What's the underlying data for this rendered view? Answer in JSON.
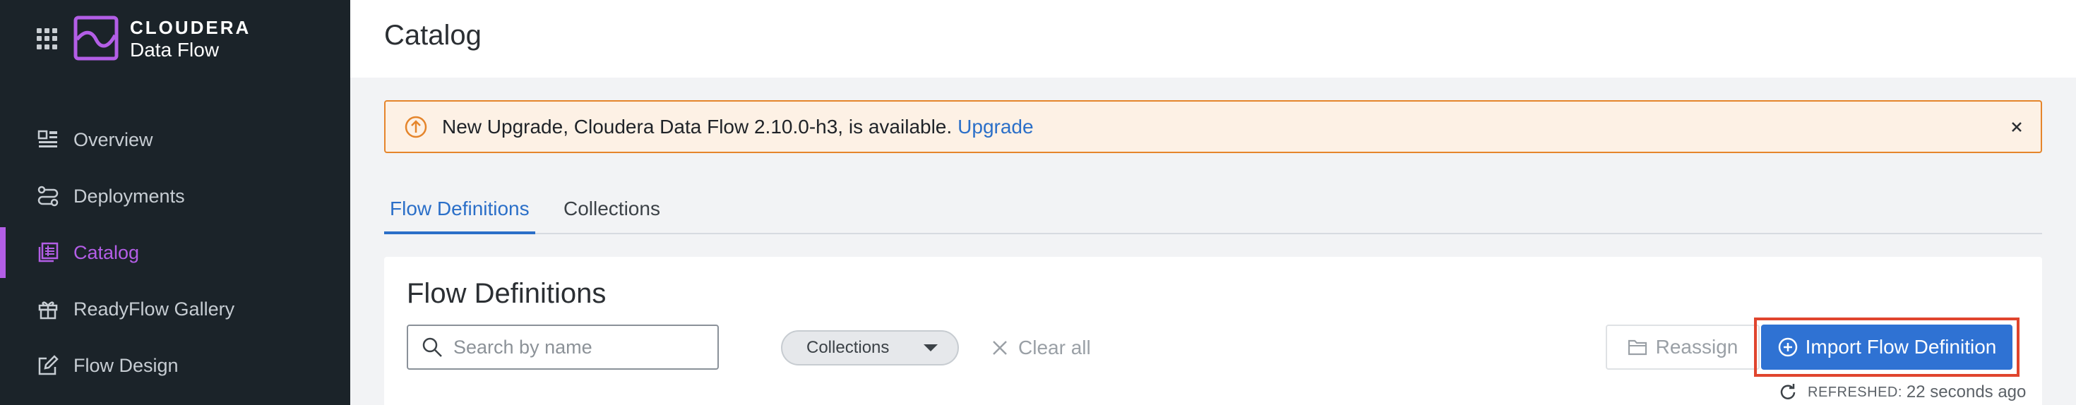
{
  "app": {
    "brand_top": "CLOUDERA",
    "brand_bottom": "Data Flow",
    "accent_color": "#b35ee6"
  },
  "sidebar": {
    "items": [
      {
        "label": "Overview",
        "icon": "overview-icon"
      },
      {
        "label": "Deployments",
        "icon": "deployments-icon"
      },
      {
        "label": "Catalog",
        "icon": "catalog-icon",
        "active": true
      },
      {
        "label": "ReadyFlow Gallery",
        "icon": "gift-icon"
      },
      {
        "label": "Flow Design",
        "icon": "edit-icon"
      }
    ]
  },
  "header": {
    "title": "Catalog"
  },
  "banner": {
    "message": "New Upgrade, Cloudera Data Flow 2.10.0-h3, is available.",
    "link_label": "Upgrade",
    "color": "#e5852b"
  },
  "tabs": [
    {
      "label": "Flow Definitions",
      "active": true
    },
    {
      "label": "Collections",
      "active": false
    }
  ],
  "card": {
    "title": "Flow Definitions",
    "search_placeholder": "Search by name",
    "collections_filter": "Collections",
    "clear_all_label": "Clear all",
    "reassign_label": "Reassign",
    "import_label": "Import Flow Definition",
    "refreshed_label": "REFRESHED:",
    "refreshed_value": "22 seconds ago"
  }
}
